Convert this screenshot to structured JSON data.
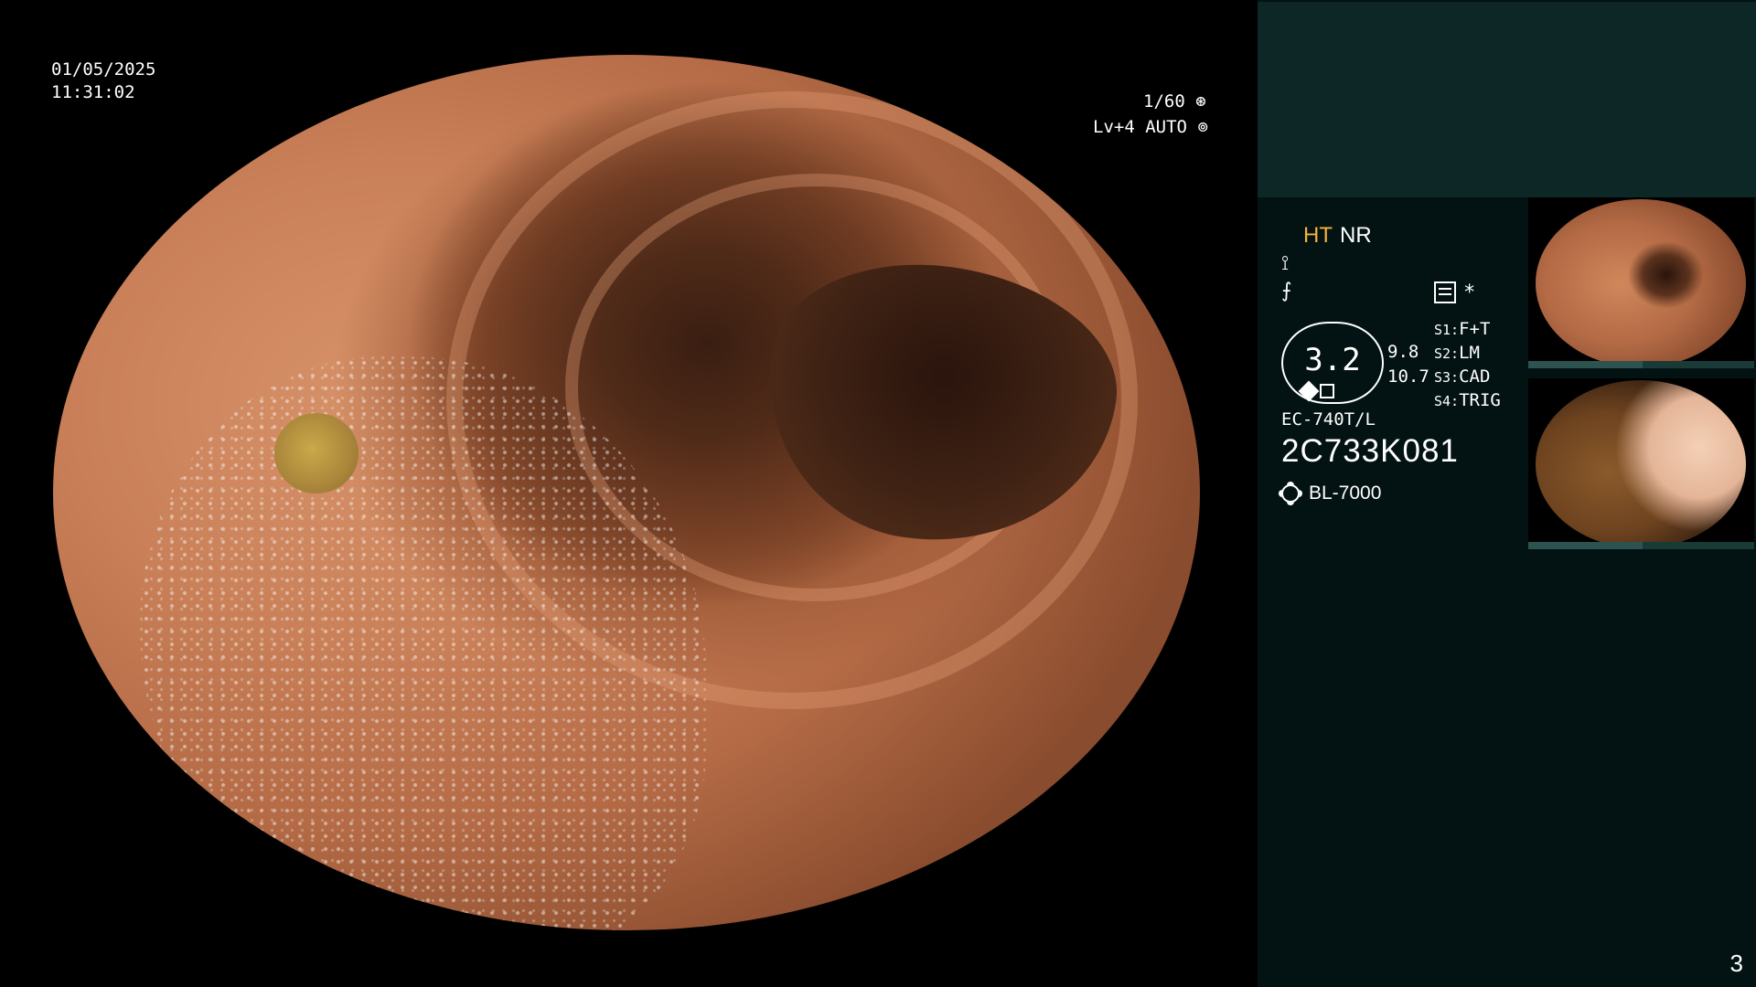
{
  "overlay": {
    "date": "01/05/2025",
    "time": "11:31:02",
    "shutter": "1/60",
    "shutter_icon": "aperture-icon",
    "level": "Lv+4",
    "mode": "AUTO",
    "mode_icon": "iris-icon"
  },
  "panel": {
    "mode_ht": "HT",
    "mode_nr": "NR",
    "icon_1": "⟟",
    "icon_2": "⨍",
    "gauge_value": "3.2",
    "side_values": [
      "9.8",
      "10.7"
    ],
    "asterisk": "*",
    "scenes": [
      {
        "key": "S1:",
        "value": "F+T"
      },
      {
        "key": "S2:",
        "value": "LM"
      },
      {
        "key": "S3:",
        "value": "CAD"
      },
      {
        "key": "S4:",
        "value": "TRIG"
      }
    ],
    "scope_model": "EC-740T/L",
    "serial": "2C733K081",
    "light_source": "BL-7000",
    "page_number": "3"
  },
  "colors": {
    "ht_accent": "#f6b13a",
    "panel_bg": "#031212",
    "panel_top_bg": "#0d2726"
  }
}
